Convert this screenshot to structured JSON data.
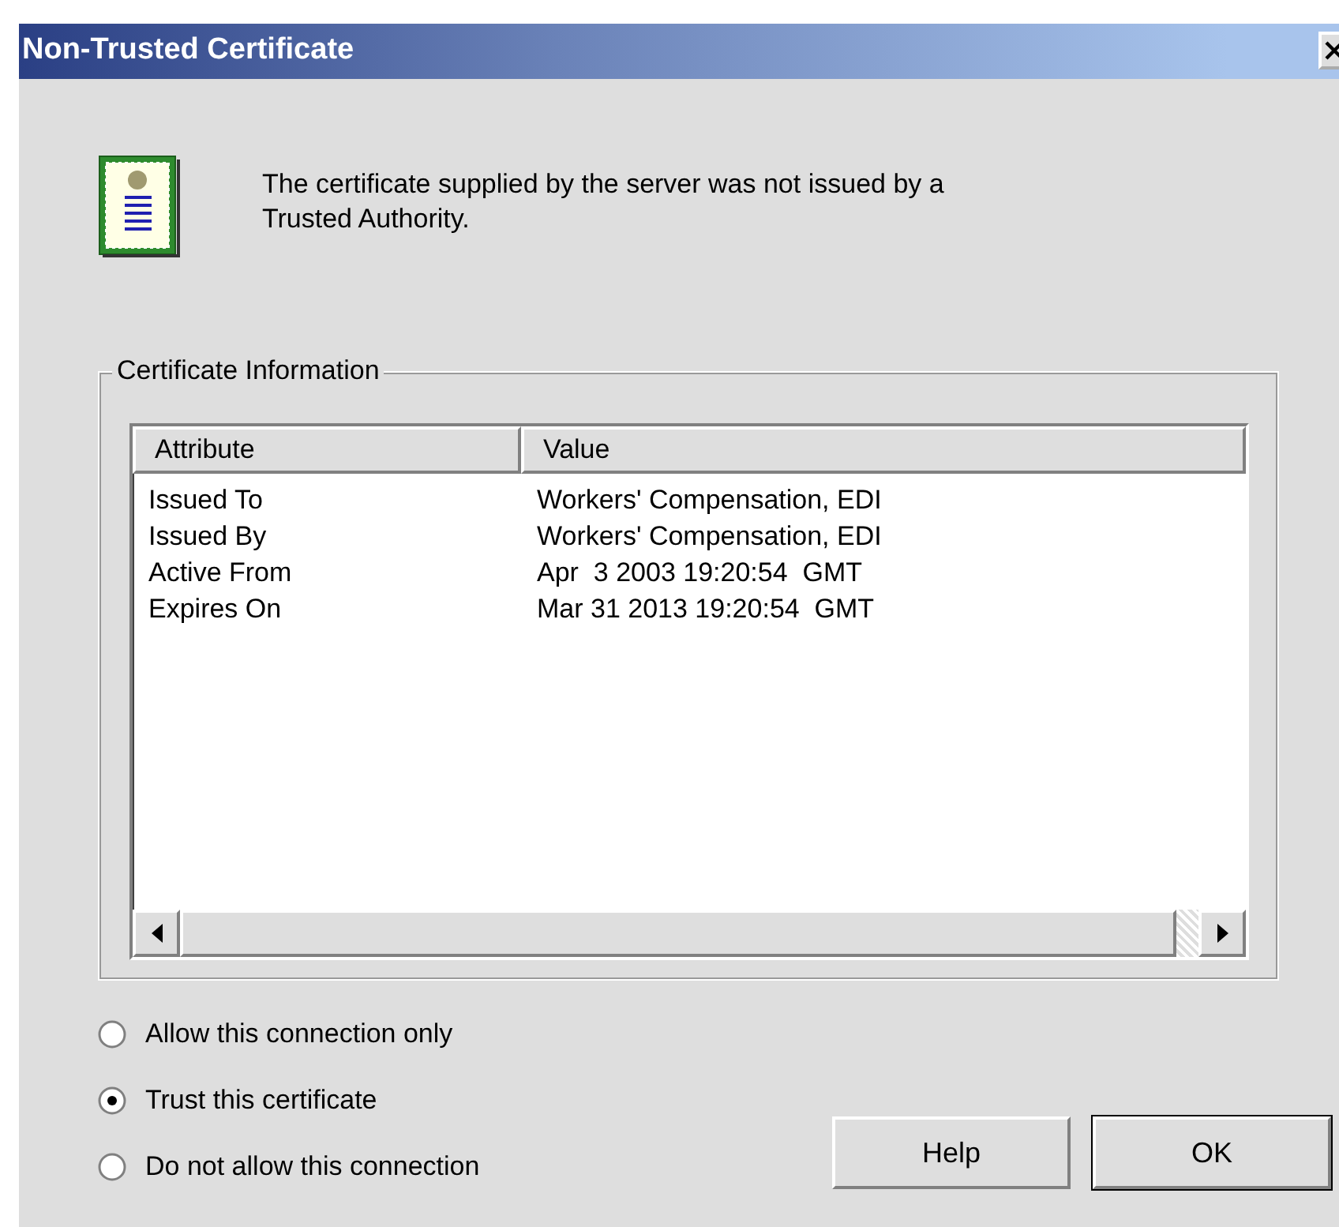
{
  "window": {
    "title": "Non-Trusted Certificate"
  },
  "message": "The certificate supplied by the server was not issued by a Trusted Authority.",
  "group": {
    "label": "Certificate Information"
  },
  "table": {
    "columns": [
      "Attribute",
      "Value"
    ],
    "rows": [
      [
        "Issued To",
        "Workers' Compensation, EDI"
      ],
      [
        "Issued By",
        "Workers' Compensation, EDI"
      ],
      [
        "Active From",
        "Apr  3 2003 19:20:54  GMT"
      ],
      [
        "Expires On",
        "Mar 31 2013 19:20:54  GMT"
      ]
    ]
  },
  "options": [
    {
      "label": "Allow this connection only",
      "selected": false
    },
    {
      "label": "Trust this certificate",
      "selected": true
    },
    {
      "label": "Do not allow this connection",
      "selected": false
    }
  ],
  "buttons": [
    {
      "label": "Help",
      "kind": "normal"
    },
    {
      "label": "OK",
      "kind": "default"
    }
  ]
}
